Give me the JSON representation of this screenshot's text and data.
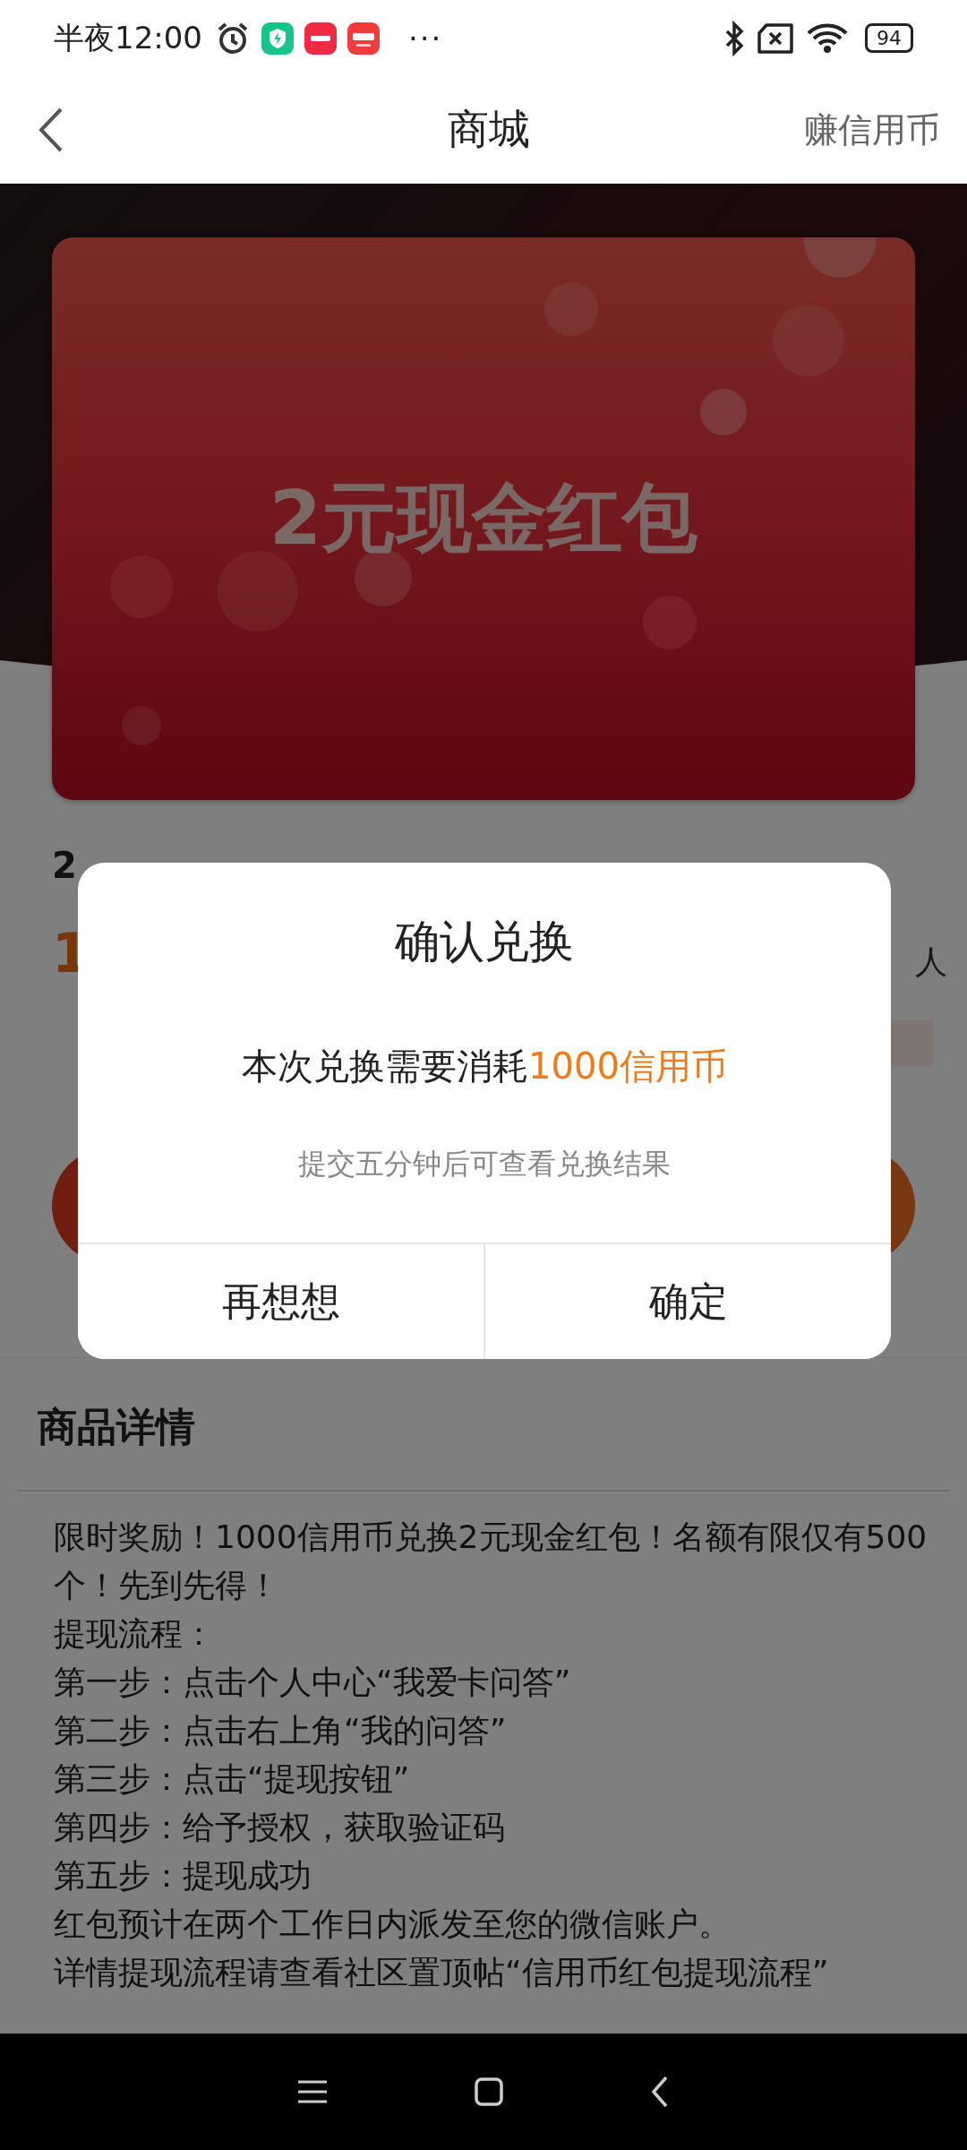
{
  "status_bar": {
    "time": "半夜12:00",
    "more": "···",
    "battery": "94"
  },
  "nav": {
    "title": "商城",
    "action": "赚信用币"
  },
  "banner": {
    "title": "2元现金红包"
  },
  "product": {
    "name": "2",
    "price": "1",
    "count": "人"
  },
  "details": {
    "heading": "商品详情",
    "lines": [
      "限时奖励！1000信用币兑换2元现金红包！名额有限仅有500个！先到先得！",
      "提现流程：",
      "第一步：点击个人中心“我爱卡问答”",
      "第二步：点击右上角“我的问答”",
      "第三步：点击“提现按钮”",
      "第四步：给予授权，获取验证码",
      "第五步：提现成功",
      "红包预计在两个工作日内派发至您的微信账户。",
      "详情提现流程请查看社区置顶帖“信用币红包提现流程”"
    ]
  },
  "dialog": {
    "title": "确认兑换",
    "message": "本次兑换需要消耗",
    "highlight": "1000信用币",
    "note": "提交五分钟后可查看兑换结果",
    "buttons": [
      {
        "label": "再想想"
      },
      {
        "label": "确定"
      }
    ]
  }
}
